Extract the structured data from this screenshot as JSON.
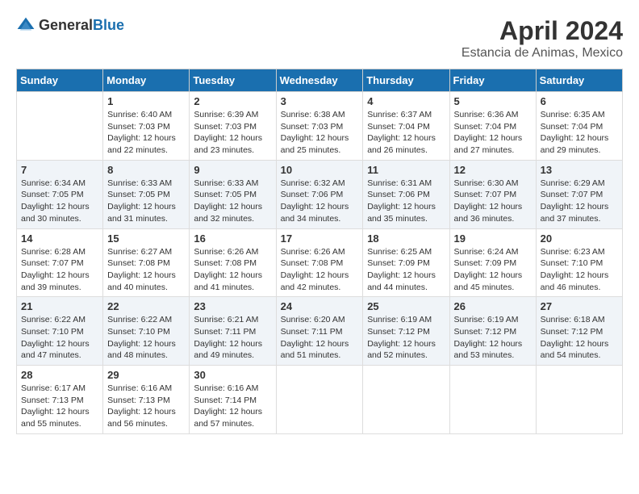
{
  "header": {
    "logo_general": "General",
    "logo_blue": "Blue",
    "month_title": "April 2024",
    "location": "Estancia de Animas, Mexico"
  },
  "calendar": {
    "days_of_week": [
      "Sunday",
      "Monday",
      "Tuesday",
      "Wednesday",
      "Thursday",
      "Friday",
      "Saturday"
    ],
    "weeks": [
      [
        {
          "day": "",
          "sunrise": "",
          "sunset": "",
          "daylight": ""
        },
        {
          "day": "1",
          "sunrise": "Sunrise: 6:40 AM",
          "sunset": "Sunset: 7:03 PM",
          "daylight": "Daylight: 12 hours and 22 minutes."
        },
        {
          "day": "2",
          "sunrise": "Sunrise: 6:39 AM",
          "sunset": "Sunset: 7:03 PM",
          "daylight": "Daylight: 12 hours and 23 minutes."
        },
        {
          "day": "3",
          "sunrise": "Sunrise: 6:38 AM",
          "sunset": "Sunset: 7:03 PM",
          "daylight": "Daylight: 12 hours and 25 minutes."
        },
        {
          "day": "4",
          "sunrise": "Sunrise: 6:37 AM",
          "sunset": "Sunset: 7:04 PM",
          "daylight": "Daylight: 12 hours and 26 minutes."
        },
        {
          "day": "5",
          "sunrise": "Sunrise: 6:36 AM",
          "sunset": "Sunset: 7:04 PM",
          "daylight": "Daylight: 12 hours and 27 minutes."
        },
        {
          "day": "6",
          "sunrise": "Sunrise: 6:35 AM",
          "sunset": "Sunset: 7:04 PM",
          "daylight": "Daylight: 12 hours and 29 minutes."
        }
      ],
      [
        {
          "day": "7",
          "sunrise": "Sunrise: 6:34 AM",
          "sunset": "Sunset: 7:05 PM",
          "daylight": "Daylight: 12 hours and 30 minutes."
        },
        {
          "day": "8",
          "sunrise": "Sunrise: 6:33 AM",
          "sunset": "Sunset: 7:05 PM",
          "daylight": "Daylight: 12 hours and 31 minutes."
        },
        {
          "day": "9",
          "sunrise": "Sunrise: 6:33 AM",
          "sunset": "Sunset: 7:05 PM",
          "daylight": "Daylight: 12 hours and 32 minutes."
        },
        {
          "day": "10",
          "sunrise": "Sunrise: 6:32 AM",
          "sunset": "Sunset: 7:06 PM",
          "daylight": "Daylight: 12 hours and 34 minutes."
        },
        {
          "day": "11",
          "sunrise": "Sunrise: 6:31 AM",
          "sunset": "Sunset: 7:06 PM",
          "daylight": "Daylight: 12 hours and 35 minutes."
        },
        {
          "day": "12",
          "sunrise": "Sunrise: 6:30 AM",
          "sunset": "Sunset: 7:07 PM",
          "daylight": "Daylight: 12 hours and 36 minutes."
        },
        {
          "day": "13",
          "sunrise": "Sunrise: 6:29 AM",
          "sunset": "Sunset: 7:07 PM",
          "daylight": "Daylight: 12 hours and 37 minutes."
        }
      ],
      [
        {
          "day": "14",
          "sunrise": "Sunrise: 6:28 AM",
          "sunset": "Sunset: 7:07 PM",
          "daylight": "Daylight: 12 hours and 39 minutes."
        },
        {
          "day": "15",
          "sunrise": "Sunrise: 6:27 AM",
          "sunset": "Sunset: 7:08 PM",
          "daylight": "Daylight: 12 hours and 40 minutes."
        },
        {
          "day": "16",
          "sunrise": "Sunrise: 6:26 AM",
          "sunset": "Sunset: 7:08 PM",
          "daylight": "Daylight: 12 hours and 41 minutes."
        },
        {
          "day": "17",
          "sunrise": "Sunrise: 6:26 AM",
          "sunset": "Sunset: 7:08 PM",
          "daylight": "Daylight: 12 hours and 42 minutes."
        },
        {
          "day": "18",
          "sunrise": "Sunrise: 6:25 AM",
          "sunset": "Sunset: 7:09 PM",
          "daylight": "Daylight: 12 hours and 44 minutes."
        },
        {
          "day": "19",
          "sunrise": "Sunrise: 6:24 AM",
          "sunset": "Sunset: 7:09 PM",
          "daylight": "Daylight: 12 hours and 45 minutes."
        },
        {
          "day": "20",
          "sunrise": "Sunrise: 6:23 AM",
          "sunset": "Sunset: 7:10 PM",
          "daylight": "Daylight: 12 hours and 46 minutes."
        }
      ],
      [
        {
          "day": "21",
          "sunrise": "Sunrise: 6:22 AM",
          "sunset": "Sunset: 7:10 PM",
          "daylight": "Daylight: 12 hours and 47 minutes."
        },
        {
          "day": "22",
          "sunrise": "Sunrise: 6:22 AM",
          "sunset": "Sunset: 7:10 PM",
          "daylight": "Daylight: 12 hours and 48 minutes."
        },
        {
          "day": "23",
          "sunrise": "Sunrise: 6:21 AM",
          "sunset": "Sunset: 7:11 PM",
          "daylight": "Daylight: 12 hours and 49 minutes."
        },
        {
          "day": "24",
          "sunrise": "Sunrise: 6:20 AM",
          "sunset": "Sunset: 7:11 PM",
          "daylight": "Daylight: 12 hours and 51 minutes."
        },
        {
          "day": "25",
          "sunrise": "Sunrise: 6:19 AM",
          "sunset": "Sunset: 7:12 PM",
          "daylight": "Daylight: 12 hours and 52 minutes."
        },
        {
          "day": "26",
          "sunrise": "Sunrise: 6:19 AM",
          "sunset": "Sunset: 7:12 PM",
          "daylight": "Daylight: 12 hours and 53 minutes."
        },
        {
          "day": "27",
          "sunrise": "Sunrise: 6:18 AM",
          "sunset": "Sunset: 7:12 PM",
          "daylight": "Daylight: 12 hours and 54 minutes."
        }
      ],
      [
        {
          "day": "28",
          "sunrise": "Sunrise: 6:17 AM",
          "sunset": "Sunset: 7:13 PM",
          "daylight": "Daylight: 12 hours and 55 minutes."
        },
        {
          "day": "29",
          "sunrise": "Sunrise: 6:16 AM",
          "sunset": "Sunset: 7:13 PM",
          "daylight": "Daylight: 12 hours and 56 minutes."
        },
        {
          "day": "30",
          "sunrise": "Sunrise: 6:16 AM",
          "sunset": "Sunset: 7:14 PM",
          "daylight": "Daylight: 12 hours and 57 minutes."
        },
        {
          "day": "",
          "sunrise": "",
          "sunset": "",
          "daylight": ""
        },
        {
          "day": "",
          "sunrise": "",
          "sunset": "",
          "daylight": ""
        },
        {
          "day": "",
          "sunrise": "",
          "sunset": "",
          "daylight": ""
        },
        {
          "day": "",
          "sunrise": "",
          "sunset": "",
          "daylight": ""
        }
      ]
    ]
  }
}
